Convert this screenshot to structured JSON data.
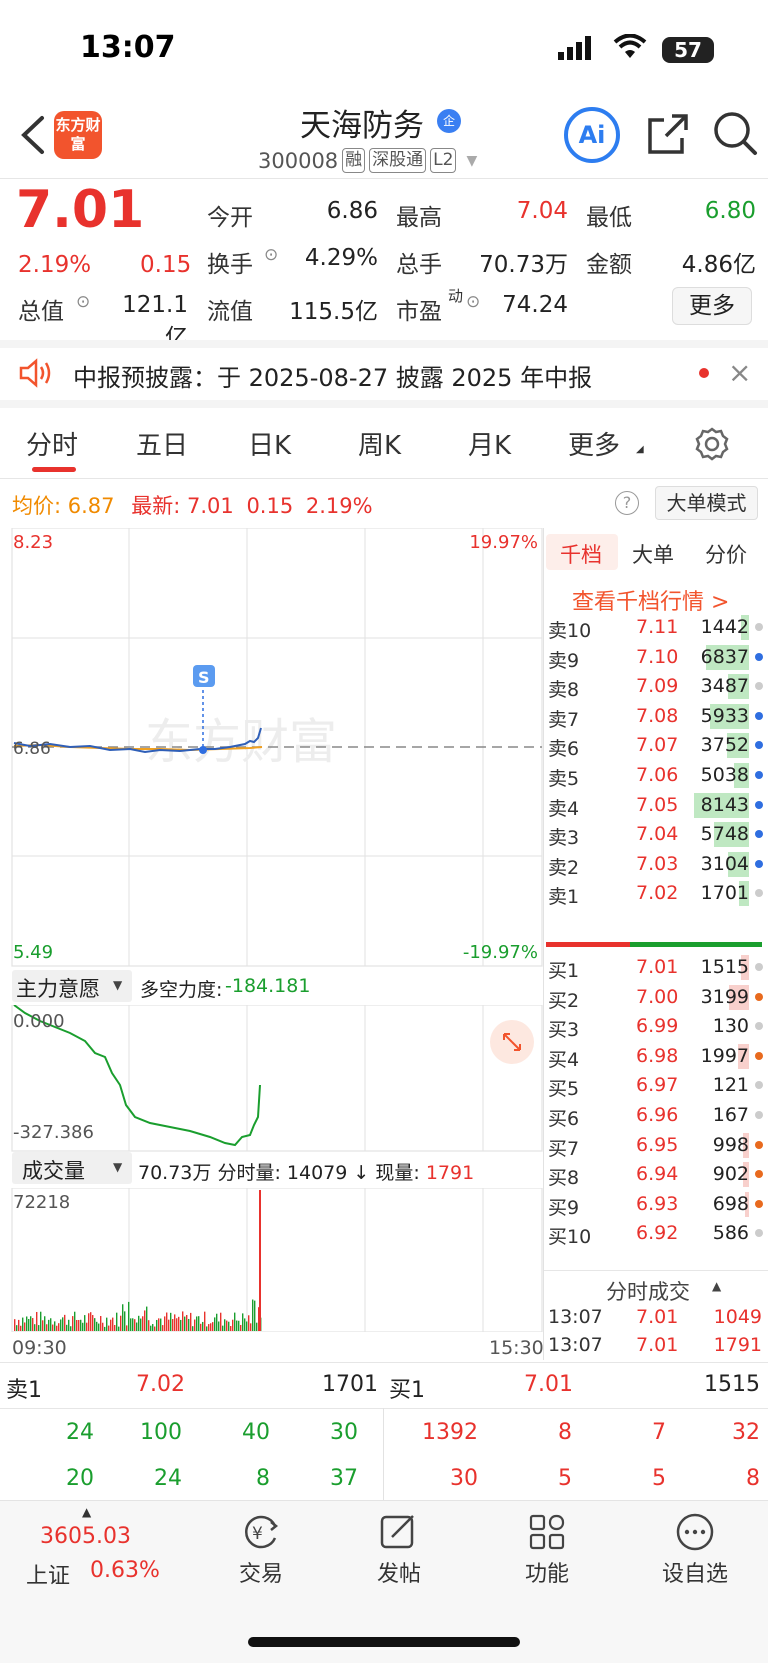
{
  "status_bar": {
    "time": "13:07",
    "battery": "57"
  },
  "header": {
    "logo_text": "东方财富",
    "stock_name": "天海防务",
    "verified_badge": "企",
    "code": "300008",
    "tags": [
      "融",
      "深股通",
      "L2"
    ],
    "ai_label": "Ai"
  },
  "quote": {
    "price": "7.01",
    "change_pct": "2.19%",
    "change": "0.15",
    "open_label": "今开",
    "open": "6.86",
    "high_label": "最高",
    "high": "7.04",
    "low_label": "最低",
    "low": "6.80",
    "turnover_label": "换手",
    "turnover": "4.29%",
    "volume_label": "总手",
    "volume": "70.73万",
    "amount_label": "金额",
    "amount": "4.86亿",
    "mktcap_label": "总值",
    "mktcap": "121.1亿",
    "float_label": "流值",
    "float_cap": "115.5亿",
    "pe_label": "市盈",
    "pe_sup": "动",
    "pe": "74.24",
    "more_button": "更多"
  },
  "notice": {
    "text": "中报预披露：于 2025-08-27 披露 2025 年中报"
  },
  "tabs": [
    "分时",
    "五日",
    "日K",
    "周K",
    "月K",
    "更多"
  ],
  "info_row": {
    "avg_label": "均价:",
    "avg": "6.87",
    "latest_label": "最新:",
    "latest": "7.01",
    "change": "0.15",
    "change_pct": "2.19%",
    "mode_button": "大单模式"
  },
  "price_chart": {
    "y_max": "8.23",
    "y_min": "5.49",
    "pct_max": "19.97%",
    "pct_min": "-19.97%",
    "ref_price": "6.86",
    "marker": "S",
    "watermark": "东方财富"
  },
  "order_book_tabs": [
    "千档",
    "大单",
    "分价"
  ],
  "order_book_link": "查看千档行情 >",
  "sell_orders": [
    {
      "label": "卖10",
      "price": "7.11",
      "vol": "1442",
      "fill": 0.12,
      "dot": "#cccccc"
    },
    {
      "label": "卖9",
      "price": "7.10",
      "vol": "6837",
      "fill": 0.62,
      "dot": "#2f6ee0"
    },
    {
      "label": "卖8",
      "price": "7.09",
      "vol": "3487",
      "fill": 0.3,
      "dot": "#cccccc"
    },
    {
      "label": "卖7",
      "price": "7.08",
      "vol": "5933",
      "fill": 0.55,
      "dot": "#2f6ee0"
    },
    {
      "label": "卖6",
      "price": "7.07",
      "vol": "3752",
      "fill": 0.32,
      "dot": "#2f6ee0"
    },
    {
      "label": "卖5",
      "price": "7.06",
      "vol": "5038",
      "fill": 0.22,
      "dot": "#2f6ee0"
    },
    {
      "label": "卖4",
      "price": "7.05",
      "vol": "8143",
      "fill": 0.78,
      "dot": "#2f6ee0"
    },
    {
      "label": "卖3",
      "price": "7.04",
      "vol": "5748",
      "fill": 0.5,
      "dot": "#2f6ee0"
    },
    {
      "label": "卖2",
      "price": "7.03",
      "vol": "3104",
      "fill": 0.3,
      "dot": "#2f6ee0"
    },
    {
      "label": "卖1",
      "price": "7.02",
      "vol": "1701",
      "fill": 0.14,
      "dot": "#cccccc"
    }
  ],
  "buy_orders": [
    {
      "label": "买1",
      "price": "7.01",
      "vol": "1515",
      "fill": 0.12,
      "dot": "#cccccc"
    },
    {
      "label": "买2",
      "price": "7.00",
      "vol": "3199",
      "fill": 0.28,
      "dot": "#e86a1e"
    },
    {
      "label": "买3",
      "price": "6.99",
      "vol": "130",
      "fill": 0.0,
      "dot": "#cccccc"
    },
    {
      "label": "买4",
      "price": "6.98",
      "vol": "1997",
      "fill": 0.16,
      "dot": "#e86a1e"
    },
    {
      "label": "买5",
      "price": "6.97",
      "vol": "121",
      "fill": 0.0,
      "dot": "#cccccc"
    },
    {
      "label": "买6",
      "price": "6.96",
      "vol": "167",
      "fill": 0.0,
      "dot": "#cccccc"
    },
    {
      "label": "买7",
      "price": "6.95",
      "vol": "998",
      "fill": 0.08,
      "dot": "#e86a1e"
    },
    {
      "label": "买8",
      "price": "6.94",
      "vol": "902",
      "fill": 0.08,
      "dot": "#e86a1e"
    },
    {
      "label": "买9",
      "price": "6.93",
      "vol": "698",
      "fill": 0.06,
      "dot": "#e86a1e"
    },
    {
      "label": "买10",
      "price": "6.92",
      "vol": "586",
      "fill": 0.0,
      "dot": "#cccccc"
    }
  ],
  "ticks": {
    "title": "分时成交",
    "rows": [
      {
        "time": "13:07",
        "price": "7.01",
        "vol": "1049"
      },
      {
        "time": "13:07",
        "price": "7.01",
        "vol": "1791"
      }
    ]
  },
  "indicator": {
    "selector": "主力意愿",
    "label": "多空力度:",
    "value": "-184.181",
    "y_max": "0.000",
    "y_min": "-327.386"
  },
  "volume": {
    "selector": "成交量",
    "total": "70.73万",
    "minute_label": "分时量:",
    "minute_value": "14079",
    "arrow": "↓",
    "current_label": "现量:",
    "current_value": "1791",
    "y_max": "72218",
    "t_start": "09:30",
    "t_end": "15:30"
  },
  "summary": {
    "sell_label": "卖1",
    "sell_price": "7.02",
    "sell_vol": "1701",
    "buy_label": "买1",
    "buy_price": "7.01",
    "buy_vol": "1515",
    "sell_queue": [
      "24",
      "100",
      "40",
      "30",
      "20",
      "24",
      "8",
      "37"
    ],
    "buy_queue": [
      "1392",
      "8",
      "7",
      "32",
      "30",
      "5",
      "5",
      "8"
    ]
  },
  "bottom_bar": {
    "index_value": "3605.03",
    "index_name": "上证",
    "index_change": "0.63%",
    "items": [
      "交易",
      "发帖",
      "功能",
      "设自选"
    ]
  },
  "colors": {
    "up": "#e8322d",
    "down": "#1a9e2e",
    "accent": "#f2542d",
    "avg_line": "#f0a020",
    "price_line": "#2f5fb8"
  }
}
